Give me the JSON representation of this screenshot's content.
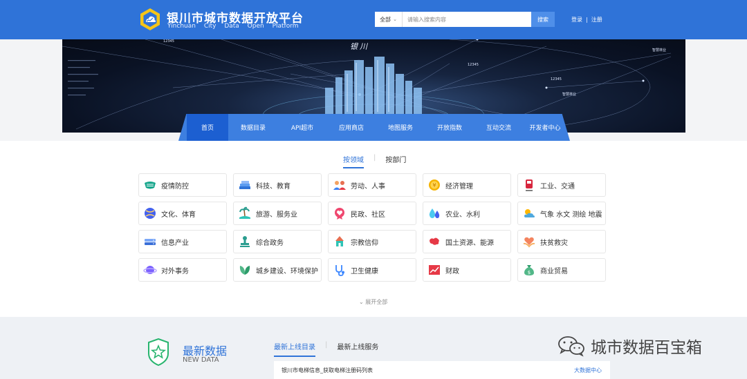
{
  "header": {
    "brand_cn": "银川市城市数据开放平台",
    "brand_en": "Yinchuan City Data Open Platform",
    "search_scope": "全部",
    "search_placeholder": "请输入搜索内容",
    "search_button": "搜索",
    "login": "登录",
    "register": "注册"
  },
  "banner": {
    "city_name": "银川",
    "labels": [
      "12345",
      "12345",
      "12345",
      "智慧林业",
      "智慧林业"
    ]
  },
  "nav": {
    "items": [
      "首页",
      "数据目录",
      "API超市",
      "应用商店",
      "地图服务",
      "开放指数",
      "互动交流",
      "开发者中心"
    ]
  },
  "categories": {
    "tabs": [
      "按领域",
      "按部门"
    ],
    "items": [
      {
        "label": "疫情防控",
        "icon": "mask-icon"
      },
      {
        "label": "科技、教育",
        "icon": "books-icon"
      },
      {
        "label": "劳动、人事",
        "icon": "people-icon"
      },
      {
        "label": "经济管理",
        "icon": "coin-icon"
      },
      {
        "label": "工业、交通",
        "icon": "train-icon"
      },
      {
        "label": "文化、体育",
        "icon": "ball-icon"
      },
      {
        "label": "旅游、服务业",
        "icon": "island-icon"
      },
      {
        "label": "民政、社区",
        "icon": "heart-badge-icon"
      },
      {
        "label": "农业、水利",
        "icon": "water-drop-icon"
      },
      {
        "label": "气象 水文 测绘 地震",
        "icon": "weather-icon"
      },
      {
        "label": "信息产业",
        "icon": "server-icon"
      },
      {
        "label": "综合政务",
        "icon": "stamp-icon"
      },
      {
        "label": "宗教信仰",
        "icon": "temple-icon"
      },
      {
        "label": "国土资源、能源",
        "icon": "map-icon"
      },
      {
        "label": "扶贫救灾",
        "icon": "hands-heart-icon"
      },
      {
        "label": "对外事务",
        "icon": "globe-icon"
      },
      {
        "label": "城乡建设、环境保护",
        "icon": "leaf-icon"
      },
      {
        "label": "卫生健康",
        "icon": "stethoscope-icon"
      },
      {
        "label": "财政",
        "icon": "finance-chart-icon"
      },
      {
        "label": "商业贸易",
        "icon": "money-bag-icon"
      }
    ],
    "expand_label": "展开全部"
  },
  "latest": {
    "title": "最新数据",
    "subtitle": "NEW DATA",
    "tabs": [
      "最新上线目录",
      "最新上线服务"
    ],
    "row_title": "银川市电梯信息_获取电梯注册码列表",
    "row_source": "大数据中心"
  },
  "watermark": "城市数据百宝箱",
  "colors": {
    "header_blue": "#2f73d8",
    "nav_blue": "#3d7fe0",
    "nav_active": "#1c5fd1"
  }
}
